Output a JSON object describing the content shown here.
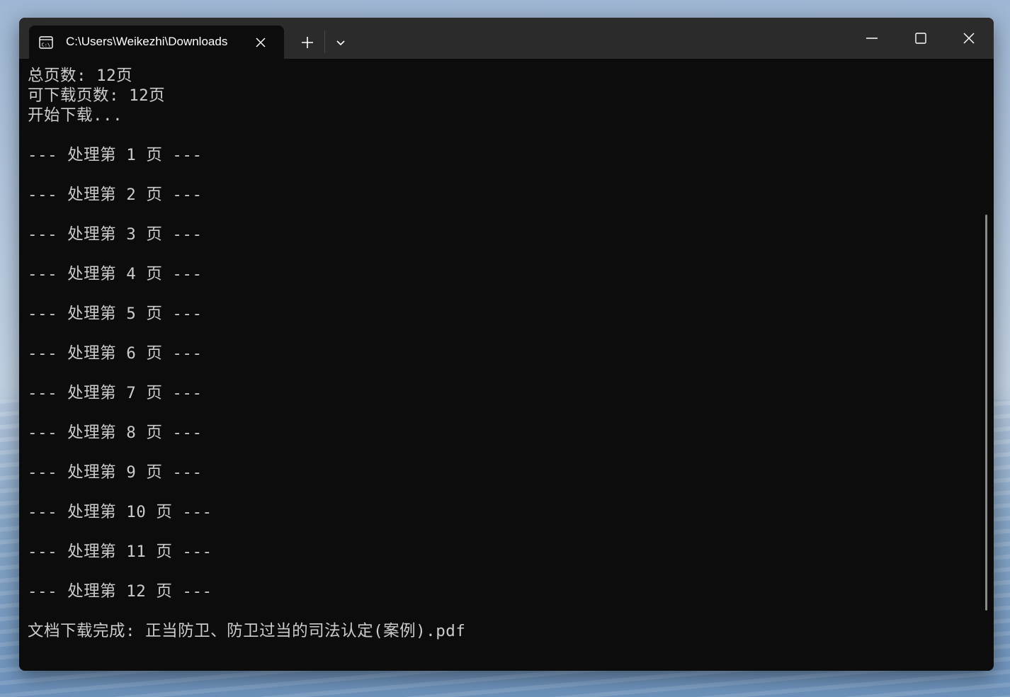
{
  "window": {
    "tab_title": "C:\\Users\\Weikezhi\\Downloads",
    "tab_icon": "terminal-icon",
    "new_tab_icon": "plus-icon",
    "dropdown_icon": "chevron-down-icon",
    "minimize_icon": "minimize-icon",
    "maximize_icon": "maximize-icon",
    "close_icon": "close-icon"
  },
  "console": {
    "lines": [
      "总页数: 12页",
      "可下载页数: 12页",
      "开始下载...",
      "",
      "--- 处理第 1 页 ---",
      "",
      "--- 处理第 2 页 ---",
      "",
      "--- 处理第 3 页 ---",
      "",
      "--- 处理第 4 页 ---",
      "",
      "--- 处理第 5 页 ---",
      "",
      "--- 处理第 6 页 ---",
      "",
      "--- 处理第 7 页 ---",
      "",
      "--- 处理第 8 页 ---",
      "",
      "--- 处理第 9 页 ---",
      "",
      "--- 处理第 10 页 ---",
      "",
      "--- 处理第 11 页 ---",
      "",
      "--- 处理第 12 页 ---",
      "",
      "文档下载完成: 正当防卫、防卫过当的司法认定(案例).pdf"
    ]
  },
  "colors": {
    "terminal_bg": "#0c0c0c",
    "titlebar_bg": "#2b2b2b",
    "text": "#cccccc"
  }
}
